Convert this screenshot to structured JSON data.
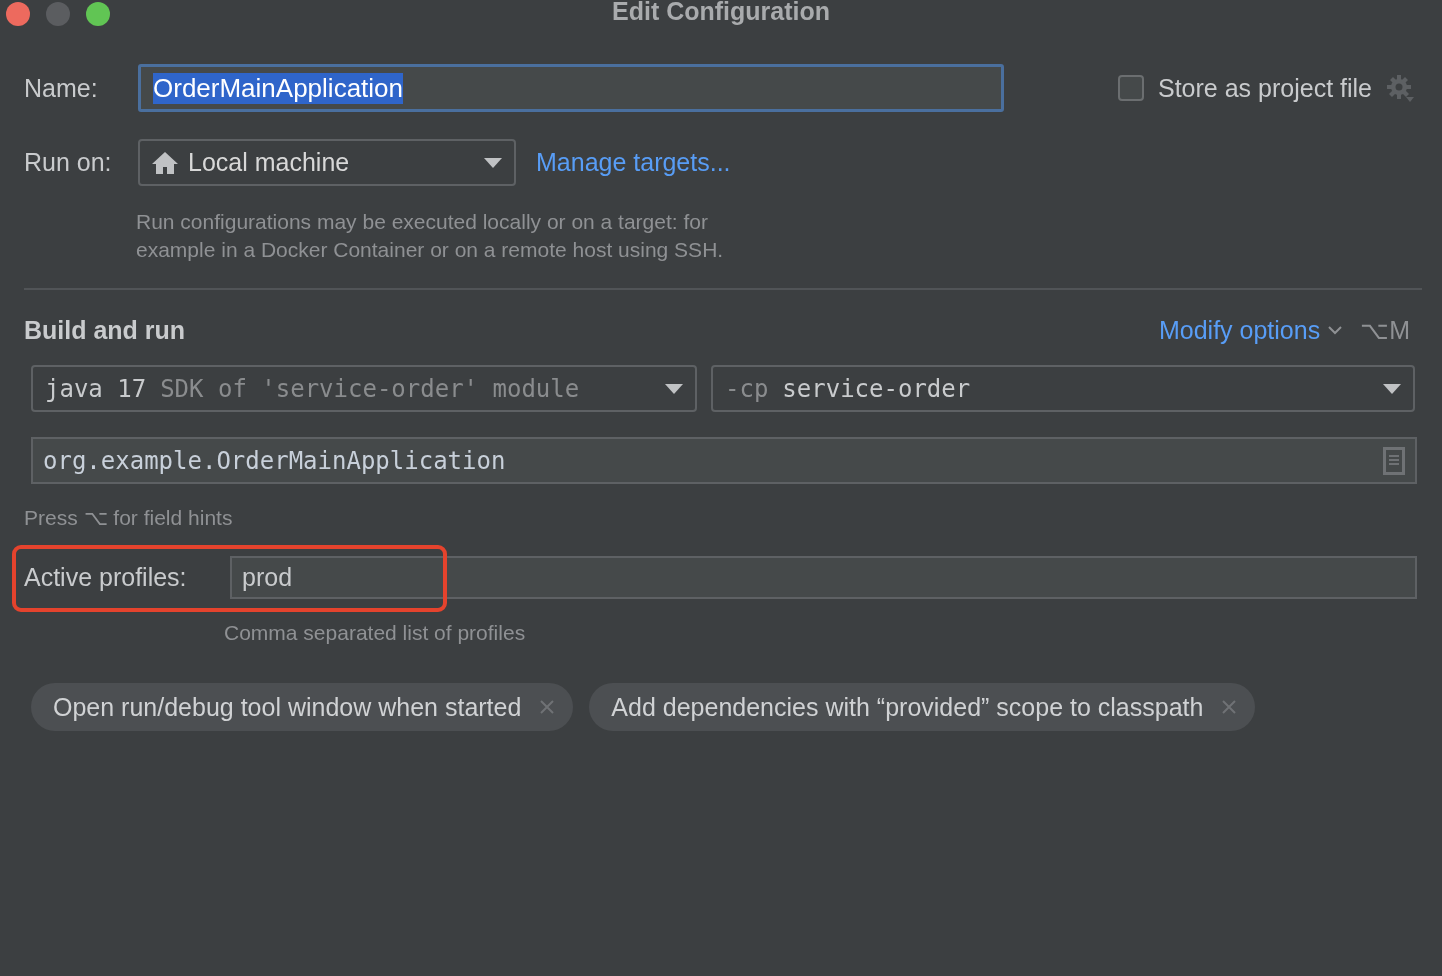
{
  "window": {
    "title": "Edit Configuration"
  },
  "name_field": {
    "label": "Name:",
    "value": "OrderMainApplication",
    "focused": true,
    "text_selected": true
  },
  "store_as_project_file": {
    "label": "Store as project file",
    "checked": false
  },
  "run_on": {
    "label": "Run on:",
    "value": "Local machine",
    "link": "Manage targets...",
    "hint_lines": [
      "Run configurations may be executed locally or on a target: for",
      "example in a Docker Container or on a remote host using SSH."
    ]
  },
  "build_and_run": {
    "title": "Build and run",
    "modify_options": "Modify options",
    "shortcut": "⌥M"
  },
  "jdk": {
    "value": "java 17",
    "hint": "SDK of 'service-order' module"
  },
  "classpath": {
    "prefix": "-cp",
    "value": "service-order"
  },
  "main_class": {
    "value": "org.example.OrderMainApplication"
  },
  "field_hints": "Press ⌥ for field hints",
  "active_profiles": {
    "label": "Active profiles:",
    "value": "prod",
    "hint": "Comma separated list of profiles",
    "highlighted": true
  },
  "chips": [
    {
      "label": "Open run/debug tool window when started"
    },
    {
      "label": "Add dependencies with “provided” scope to classpath"
    }
  ]
}
